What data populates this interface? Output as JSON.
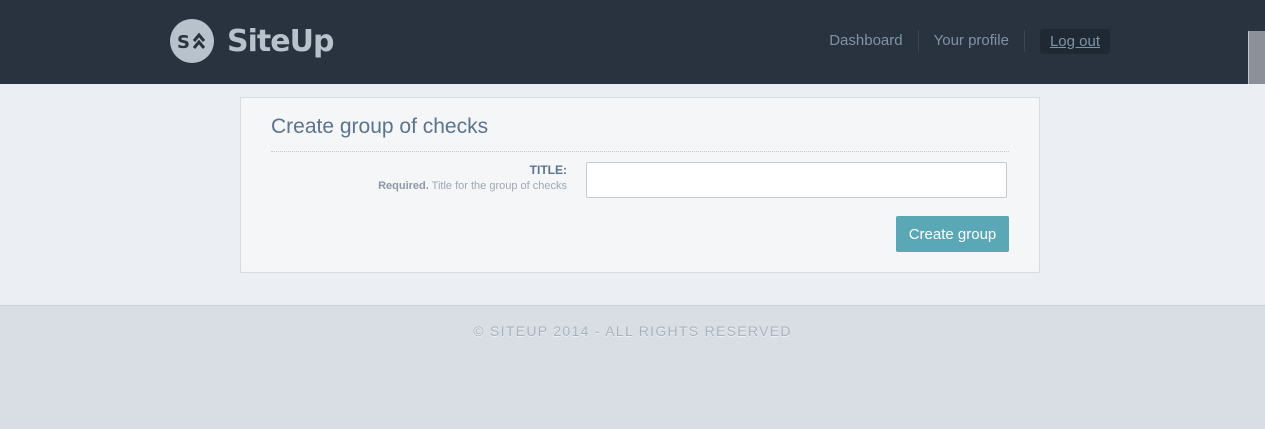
{
  "header": {
    "brand_name": "SiteUp",
    "logo_icon": "siteup-logo-icon",
    "nav": {
      "dashboard_label": "Dashboard",
      "profile_label": "Your profile",
      "logout_label": "Log out"
    }
  },
  "form": {
    "heading": "Create group of checks",
    "title_field": {
      "label": "TITLE:",
      "required_label": "Required.",
      "help_text": " Title for the group of checks",
      "value": "",
      "placeholder": ""
    },
    "submit_label": "Create group"
  },
  "footer": {
    "copyright": "© SITEUP 2014 - ALL RIGHTS RESERVED"
  },
  "colors": {
    "header_bg": "#29333f",
    "accent": "#5aa7b5",
    "heading": "#5a7490"
  }
}
